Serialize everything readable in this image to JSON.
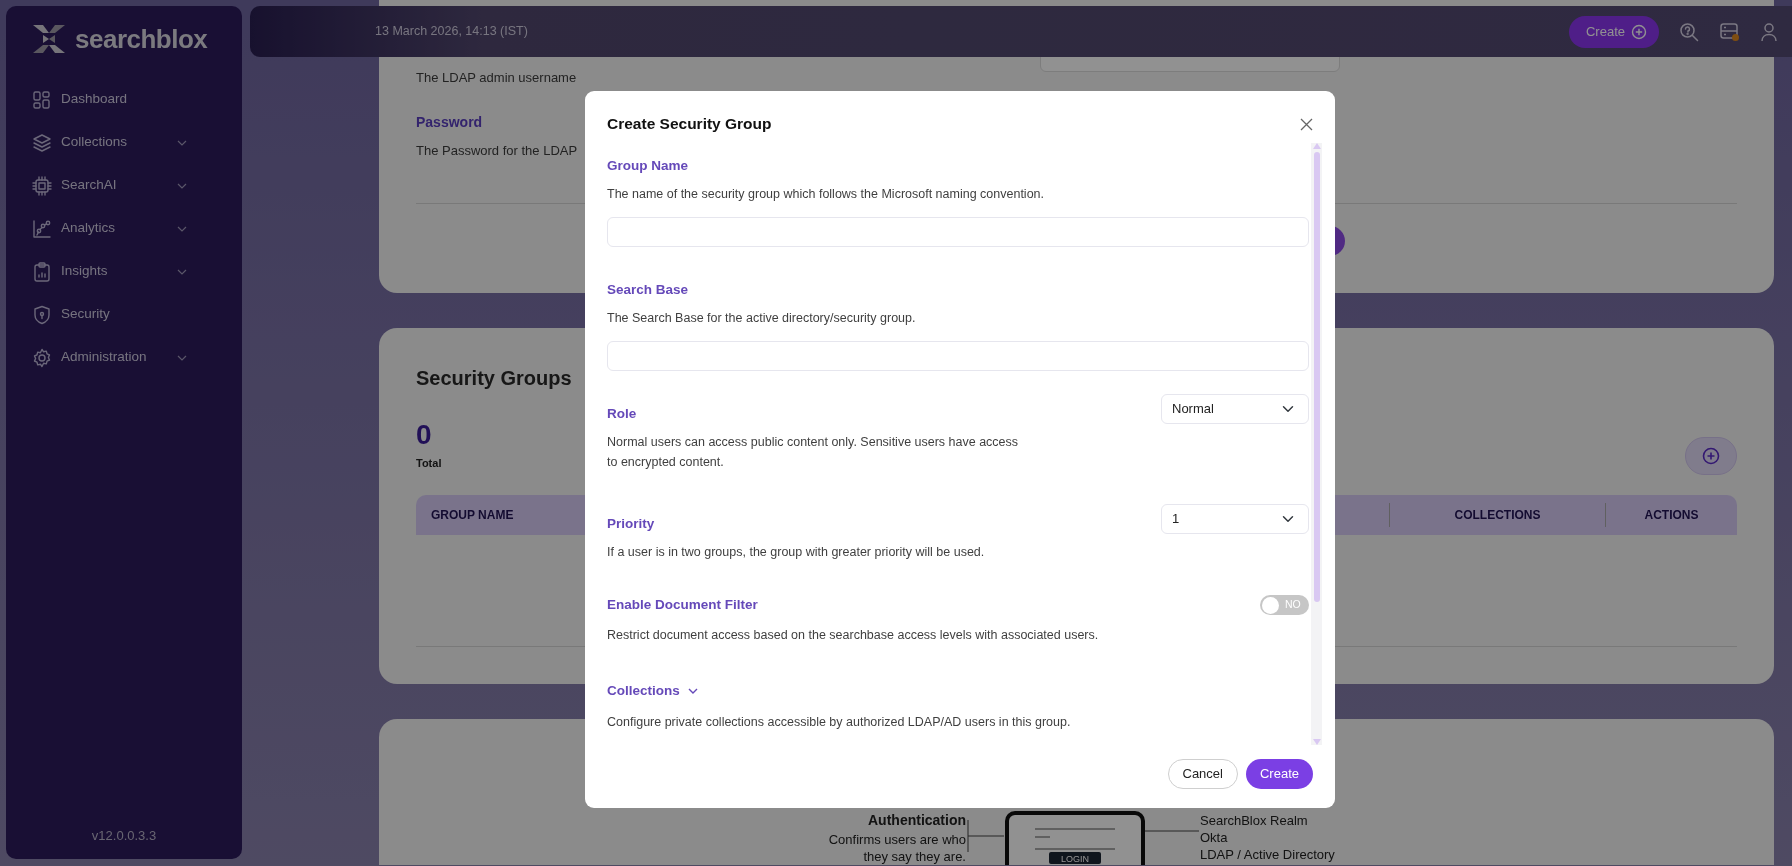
{
  "sidebar": {
    "logo_text": "searchblox",
    "items": [
      {
        "label": "Dashboard",
        "has_submenu": false
      },
      {
        "label": "Collections",
        "has_submenu": true
      },
      {
        "label": "SearchAI",
        "has_submenu": true
      },
      {
        "label": "Analytics",
        "has_submenu": true
      },
      {
        "label": "Insights",
        "has_submenu": true
      },
      {
        "label": "Security",
        "has_submenu": false
      },
      {
        "label": "Administration",
        "has_submenu": true
      }
    ],
    "version": "v12.0.0.3.3"
  },
  "header": {
    "datetime": "13 March 2026, 14:13 (IST)",
    "create_button": "Create",
    "server_alert": true
  },
  "ldap_card": {
    "username_help": "The LDAP admin username",
    "password_label": "Password",
    "password_help": "The Password for the LDAP"
  },
  "security_groups": {
    "title": "Security Groups",
    "count": "0",
    "count_label": "Total",
    "columns": [
      "GROUP NAME",
      "COLLECTIONS",
      "ACTIONS"
    ]
  },
  "auth_illustration": {
    "left_title": "Authentication",
    "left_lines": [
      "Confirms users are who",
      "they say they are."
    ],
    "login_button": "LOGIN",
    "providers": [
      "SearchBlox Realm",
      "Okta",
      "LDAP / Active Directory"
    ]
  },
  "modal": {
    "title": "Create Security Group",
    "fields": [
      {
        "kind": "text",
        "label": "Group Name",
        "help": "The name of the security group which follows the Microsoft naming convention."
      },
      {
        "kind": "text",
        "label": "Search Base",
        "help": "The Search Base for the active directory/security group."
      },
      {
        "kind": "select",
        "label": "Role",
        "help": "Normal users can access public content only. Sensitive users have access to encrypted content.",
        "value": "Normal"
      },
      {
        "kind": "select",
        "label": "Priority",
        "help": "If a user is in two groups, the group with greater priority will be used.",
        "value": "1"
      },
      {
        "kind": "toggle",
        "label": "Enable Document Filter",
        "help": "Restrict document access based on the searchbase access levels with associated users.",
        "on": false,
        "toggle_text": "NO"
      },
      {
        "kind": "collapsible",
        "label": "Collections",
        "help": "Configure private collections accessible by authorized LDAP/AD users in this group.",
        "expanded": false
      }
    ],
    "buttons": [
      {
        "label": "Cancel",
        "kind": "secondary"
      },
      {
        "label": "Create",
        "kind": "primary"
      }
    ]
  }
}
